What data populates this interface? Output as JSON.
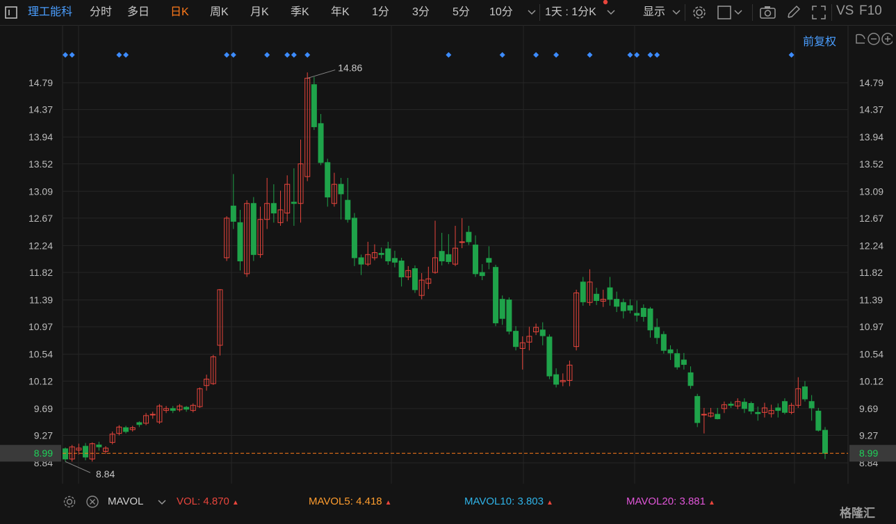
{
  "toolbar": {
    "menu_icon": "menu-icon",
    "stock_name": "理工能科",
    "periods": [
      "分时",
      "多日",
      "日K",
      "周K",
      "月K",
      "季K",
      "年K",
      "1分",
      "3分",
      "5分",
      "10分"
    ],
    "active_period": "日K",
    "multi_period": "1天 : 1分K",
    "display": "显示",
    "vs": "VS",
    "f10": "F10"
  },
  "adjust_label": "前复权",
  "colors": {
    "up": "#e8453c",
    "down": "#1fa34a",
    "last_price": "#ff7a1a",
    "accent": "#4a9eff",
    "marker": "#3d8cff"
  },
  "chart_data": {
    "type": "candlestick",
    "y_ticks": [
      "14.79",
      "14.37",
      "13.94",
      "13.52",
      "13.09",
      "12.67",
      "12.24",
      "11.82",
      "11.39",
      "10.97",
      "10.54",
      "10.12",
      "9.69",
      "9.27",
      "8.84"
    ],
    "ylim": [
      8.76,
      15.16
    ],
    "last_price": "8.99",
    "high_label": "14.86",
    "low_label": "8.84",
    "candles": [
      [
        9.06,
        8.9,
        9.08,
        8.86
      ],
      [
        8.9,
        9.09,
        9.12,
        8.86
      ],
      [
        9.04,
        9.07,
        9.14,
        8.97
      ],
      [
        9.1,
        8.93,
        9.15,
        8.88
      ],
      [
        8.9,
        9.14,
        9.16,
        8.86
      ],
      [
        9.12,
        9.09,
        9.17,
        9.03
      ],
      [
        9.02,
        9.07,
        9.1,
        8.98
      ],
      [
        9.16,
        9.29,
        9.33,
        9.13
      ],
      [
        9.3,
        9.4,
        9.43,
        9.27
      ],
      [
        9.39,
        9.33,
        9.42,
        9.3
      ],
      [
        9.36,
        9.39,
        9.42,
        9.33
      ],
      [
        9.47,
        9.44,
        9.49,
        9.4
      ],
      [
        9.46,
        9.58,
        9.62,
        9.43
      ],
      [
        9.59,
        9.6,
        9.64,
        9.53
      ],
      [
        9.48,
        9.73,
        9.76,
        9.45
      ],
      [
        9.66,
        9.69,
        9.73,
        9.62
      ],
      [
        9.69,
        9.66,
        9.73,
        9.62
      ],
      [
        9.67,
        9.73,
        9.76,
        9.64
      ],
      [
        9.71,
        9.68,
        9.73,
        9.64
      ],
      [
        9.66,
        9.74,
        9.77,
        9.63
      ],
      [
        9.72,
        10.0,
        10.02,
        9.7
      ],
      [
        10.05,
        10.15,
        10.22,
        9.97
      ],
      [
        10.08,
        10.5,
        10.53,
        10.06
      ],
      [
        10.68,
        11.55,
        11.56,
        10.52
      ],
      [
        12.05,
        12.67,
        12.7,
        12.0
      ],
      [
        12.86,
        12.62,
        13.36,
        12.5
      ],
      [
        12.6,
        12.0,
        12.8,
        11.85
      ],
      [
        11.8,
        12.9,
        12.95,
        11.75
      ],
      [
        12.9,
        12.1,
        13.0,
        12.0
      ],
      [
        12.1,
        12.65,
        12.85,
        12.05
      ],
      [
        12.65,
        12.9,
        13.3,
        12.5
      ],
      [
        12.9,
        12.75,
        13.2,
        12.6
      ],
      [
        12.6,
        12.8,
        13.1,
        12.55
      ],
      [
        12.75,
        13.2,
        13.34,
        12.62
      ],
      [
        12.92,
        12.9,
        13.45,
        12.55
      ],
      [
        12.9,
        13.52,
        13.9,
        12.6
      ],
      [
        13.32,
        14.86,
        14.95,
        13.25
      ],
      [
        14.76,
        14.1,
        14.88,
        14.05
      ],
      [
        14.15,
        13.54,
        14.3,
        13.5
      ],
      [
        13.54,
        13.0,
        13.6,
        12.85
      ],
      [
        12.9,
        13.2,
        13.38,
        12.85
      ],
      [
        13.2,
        13.05,
        13.3,
        12.65
      ],
      [
        12.95,
        12.65,
        13.3,
        12.6
      ],
      [
        12.67,
        12.05,
        12.75,
        11.92
      ],
      [
        12.05,
        11.95,
        12.1,
        11.78
      ],
      [
        11.95,
        12.1,
        12.3,
        11.92
      ],
      [
        12.05,
        12.13,
        12.26,
        12.01
      ],
      [
        12.12,
        12.1,
        12.21,
        12.04
      ],
      [
        12.19,
        12.0,
        12.3,
        11.94
      ],
      [
        12.04,
        11.98,
        12.16,
        11.9
      ],
      [
        12.0,
        11.75,
        12.05,
        11.6
      ],
      [
        11.75,
        11.85,
        11.92,
        11.7
      ],
      [
        11.88,
        11.55,
        11.93,
        11.5
      ],
      [
        11.46,
        11.7,
        11.81,
        11.4
      ],
      [
        11.65,
        11.72,
        11.91,
        11.56
      ],
      [
        11.82,
        12.05,
        12.63,
        11.8
      ],
      [
        12.15,
        12.0,
        12.44,
        11.93
      ],
      [
        12.1,
        11.99,
        12.42,
        11.95
      ],
      [
        11.95,
        12.2,
        12.55,
        11.92
      ],
      [
        12.3,
        12.3,
        12.67,
        12.2
      ],
      [
        12.45,
        12.3,
        12.55,
        12.25
      ],
      [
        12.25,
        11.8,
        12.4,
        11.75
      ],
      [
        11.82,
        11.77,
        11.95,
        11.7
      ],
      [
        12.04,
        11.98,
        12.23,
        11.87
      ],
      [
        11.9,
        11.03,
        11.94,
        10.98
      ],
      [
        11.4,
        11.1,
        11.46,
        11.0
      ],
      [
        11.39,
        10.9,
        11.43,
        10.85
      ],
      [
        10.9,
        10.66,
        10.98,
        10.6
      ],
      [
        10.63,
        10.72,
        10.82,
        10.3
      ],
      [
        10.73,
        10.82,
        10.97,
        10.6
      ],
      [
        10.89,
        10.96,
        11.02,
        10.84
      ],
      [
        10.92,
        10.83,
        11.04,
        10.68
      ],
      [
        10.81,
        10.2,
        10.85,
        10.15
      ],
      [
        10.22,
        10.07,
        10.32,
        10.02
      ],
      [
        10.11,
        10.13,
        10.24,
        10.04
      ],
      [
        10.13,
        10.37,
        10.44,
        10.04
      ],
      [
        10.66,
        11.5,
        11.55,
        10.6
      ],
      [
        11.67,
        11.36,
        11.75,
        11.3
      ],
      [
        11.35,
        11.67,
        11.87,
        11.3
      ],
      [
        11.48,
        11.38,
        11.58,
        11.31
      ],
      [
        11.37,
        11.4,
        11.55,
        11.28
      ],
      [
        11.58,
        11.4,
        11.75,
        11.3
      ],
      [
        11.4,
        11.29,
        11.52,
        11.2
      ],
      [
        11.35,
        11.22,
        11.41,
        11.1
      ],
      [
        11.3,
        11.23,
        11.4,
        11.18
      ],
      [
        11.18,
        11.15,
        11.38,
        11.05
      ],
      [
        11.26,
        11.13,
        11.32,
        11.05
      ],
      [
        11.25,
        10.92,
        11.28,
        10.8
      ],
      [
        10.96,
        10.8,
        11.1,
        10.7
      ],
      [
        10.85,
        10.6,
        10.9,
        10.55
      ],
      [
        10.61,
        10.56,
        10.68,
        10.45
      ],
      [
        10.55,
        10.34,
        10.62,
        10.3
      ],
      [
        10.45,
        10.38,
        10.56,
        10.3
      ],
      [
        10.25,
        10.05,
        10.35,
        10.0
      ],
      [
        9.88,
        9.47,
        9.92,
        9.4
      ],
      [
        9.6,
        9.6,
        9.7,
        9.3
      ],
      [
        9.57,
        9.62,
        9.7,
        9.55
      ],
      [
        9.6,
        9.53,
        9.7,
        9.52
      ],
      [
        9.69,
        9.75,
        9.8,
        9.62
      ],
      [
        9.76,
        9.74,
        9.8,
        9.7
      ],
      [
        9.73,
        9.8,
        9.85,
        9.68
      ],
      [
        9.79,
        9.69,
        9.85,
        9.62
      ],
      [
        9.77,
        9.65,
        9.8,
        9.6
      ],
      [
        9.63,
        9.61,
        9.72,
        9.5
      ],
      [
        9.63,
        9.7,
        9.78,
        9.55
      ],
      [
        9.61,
        9.66,
        9.75,
        9.55
      ],
      [
        9.7,
        9.66,
        9.77,
        9.55
      ],
      [
        9.8,
        9.63,
        9.85,
        9.6
      ],
      [
        9.63,
        9.74,
        9.78,
        9.6
      ],
      [
        9.74,
        10.0,
        10.18,
        9.7
      ],
      [
        10.03,
        9.84,
        10.12,
        9.8
      ],
      [
        9.8,
        9.7,
        9.9,
        9.5
      ],
      [
        9.65,
        9.35,
        9.7,
        9.33
      ],
      [
        9.35,
        8.99,
        9.4,
        8.9
      ]
    ],
    "event_marker_dates_idx": [
      0,
      1,
      8,
      9,
      24,
      25,
      30,
      33,
      34,
      36,
      57,
      65,
      70,
      73,
      78,
      84,
      85,
      87,
      88,
      108
    ]
  },
  "indicator": {
    "settings_icon": "gear-icon",
    "close_icon": "close-icon",
    "name": "MAVOL",
    "vol_label": "VOL:",
    "vol_value": "4.870",
    "mavol5_label": "MAVOL5:",
    "mavol5_value": "4.418",
    "mavol10_label": "MAVOL10:",
    "mavol10_value": "3.803",
    "mavol20_label": "MAVOL20:",
    "mavol20_value": "3.881",
    "mavol5_color": "#ff9d2e",
    "mavol10_color": "#2fb3e8",
    "mavol20_color": "#e055d8"
  },
  "watermark": "格隆汇"
}
